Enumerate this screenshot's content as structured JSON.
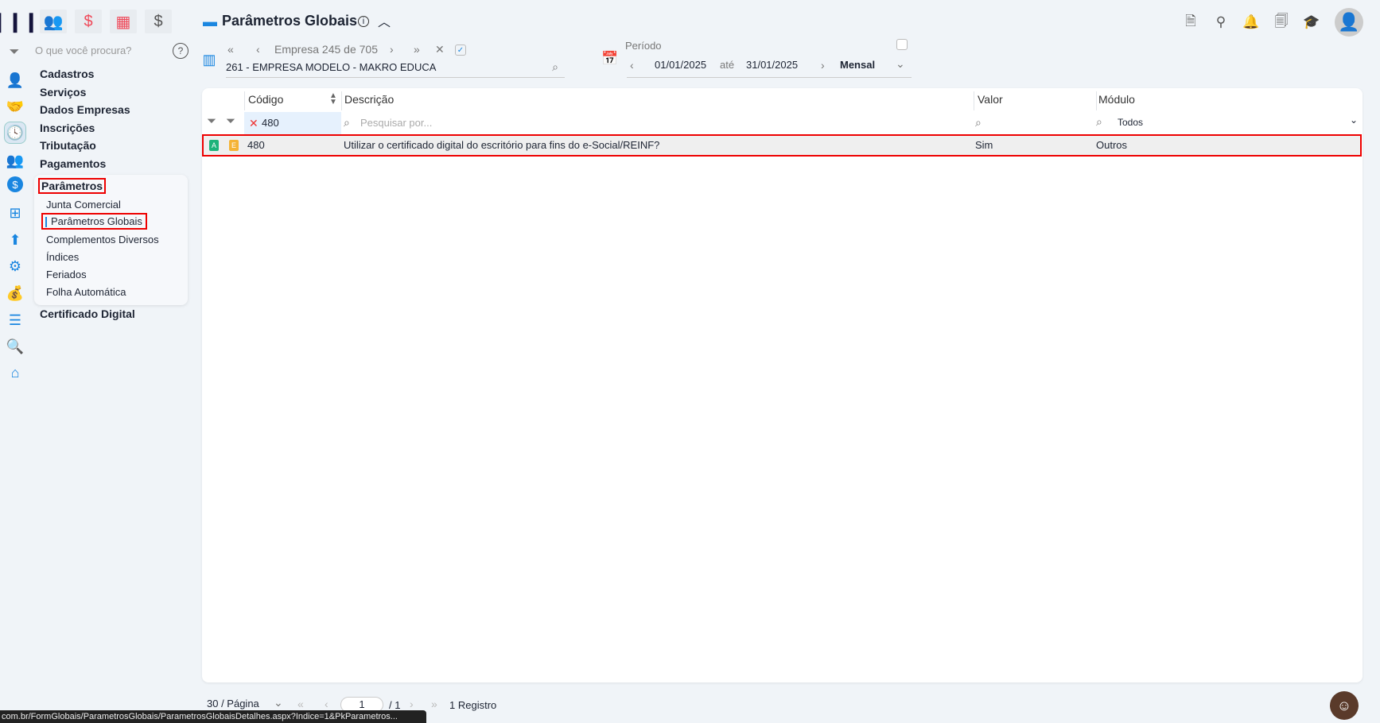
{
  "topbar": {
    "icons": [
      "logo-icon",
      "users-icon",
      "dollar-icon",
      "calculator-icon",
      "money-bag-icon"
    ],
    "title": "Parâmetros Globais",
    "right_icons": [
      "document-icon",
      "rocket-icon",
      "bell-icon",
      "search-document-icon",
      "graduation-cap-icon",
      "user-avatar-icon"
    ]
  },
  "search": {
    "placeholder": "O que você procura?"
  },
  "company": {
    "nav_label": "Empresa 245 de 705",
    "name": "261 - EMPRESA MODELO - MAKRO EDUCA"
  },
  "period": {
    "label": "Período",
    "start": "01/01/2025",
    "separator": "até",
    "end": "31/01/2025",
    "mode": "Mensal"
  },
  "sidebar": {
    "items": [
      "Cadastros",
      "Serviços",
      "Dados Empresas",
      "Inscrições",
      "Tributação",
      "Pagamentos"
    ],
    "active": "Parâmetros",
    "sub_items": [
      "Junta Comercial",
      "Parâmetros Globais",
      "Complementos Diversos",
      "Índices",
      "Feriados",
      "Folha Automática"
    ],
    "after": "Certificado Digital"
  },
  "grid": {
    "columns": [
      "Código",
      "Descrição",
      "Valor",
      "Módulo"
    ],
    "filters": {
      "codigo": "480",
      "descricao_placeholder": "Pesquisar por...",
      "modulo": "Todos"
    },
    "rows": [
      {
        "badge_a": "A",
        "badge_e": "E",
        "codigo": "480",
        "descricao": "Utilizar o certificado digital do escritório para fins do e-Social/REINF?",
        "valor": "Sim",
        "modulo": "Outros"
      }
    ]
  },
  "footer": {
    "page_size": "30 / Página",
    "page": "1",
    "total_pages": "/ 1",
    "records": "1 Registro"
  },
  "statusbar": {
    "url": "com.br/FormGlobais/ParametrosGlobais/ParametrosGlobaisDetalhes.aspx?Indice=1&PkParametros..."
  },
  "colors": {
    "accent": "#1a86e0",
    "highlight": "#e00000",
    "badge_a": "#1db37a",
    "badge_e": "#f5b335"
  }
}
